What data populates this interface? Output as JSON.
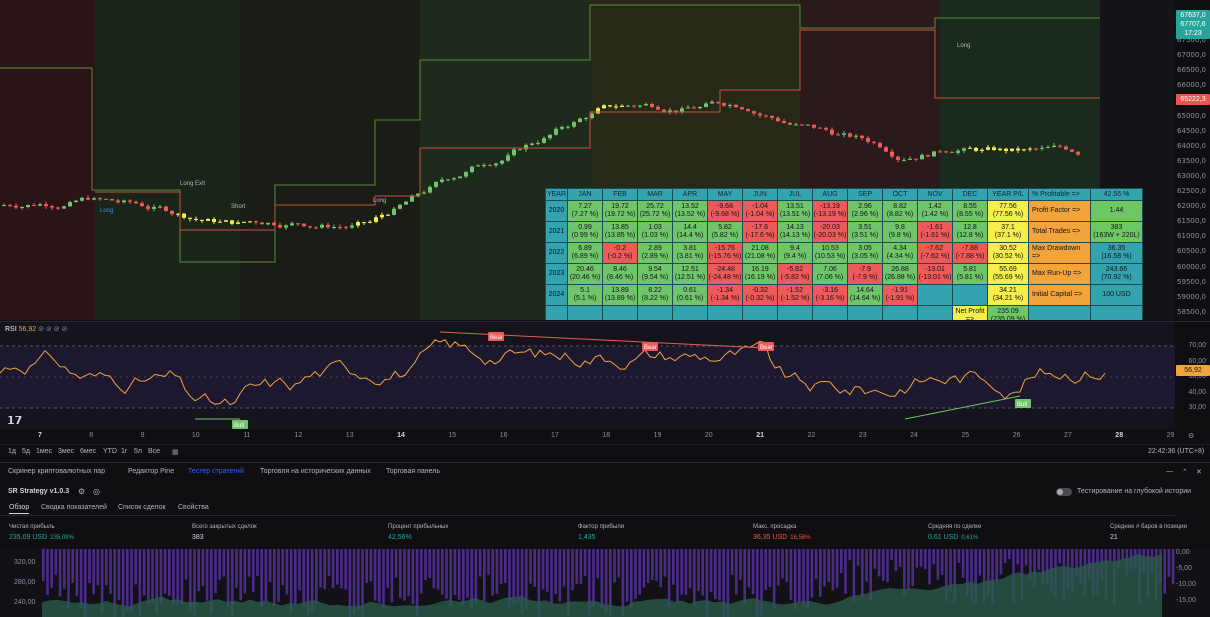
{
  "price_axis": {
    "ticks": [
      "67500,0",
      "67000,0",
      "66500,0",
      "66000,0",
      "65500,0",
      "65000,0",
      "64500,0",
      "64000,0",
      "63500,0",
      "63000,0",
      "62500,0",
      "62000,0",
      "61500,0",
      "61000,0",
      "60500,0",
      "60000,0",
      "59500,0",
      "59000,0",
      "58500,0",
      "58000,0"
    ],
    "badge_top": [
      "67637,0",
      "67707,6",
      "17:23"
    ],
    "badge_red": "65222,3"
  },
  "chart_labels": {
    "long1": "Long",
    "long_exit": "Long Exit",
    "short": "Short",
    "long2": "Long",
    "long3": "Long"
  },
  "table": {
    "headers": [
      "YEAR",
      "JAN",
      "FEB",
      "MAR",
      "APR",
      "MAY",
      "JUN",
      "JUL",
      "AUG",
      "SEP",
      "OCT",
      "NOV",
      "DEC",
      "YEAR P/L"
    ],
    "rows": [
      {
        "year": "2020",
        "cells": [
          [
            "7.27",
            "(7.27 %)",
            "pos"
          ],
          [
            "19.72",
            "(19.72 %)",
            "pos"
          ],
          [
            "25.72",
            "(25.72 %)",
            "pos"
          ],
          [
            "13.52",
            "(13.52 %)",
            "pos"
          ],
          [
            "-9.68",
            "(-9.68 %)",
            "neg"
          ],
          [
            "-1.04",
            "(-1.04 %)",
            "neg"
          ],
          [
            "13.51",
            "(13.51 %)",
            "pos"
          ],
          [
            "-13.19",
            "(-13.19 %)",
            "neg"
          ],
          [
            "2.96",
            "(2.96 %)",
            "pos"
          ],
          [
            "8.82",
            "(8.82 %)",
            "pos"
          ],
          [
            "1.42",
            "(1.42 %)",
            "pos"
          ],
          [
            "8.55",
            "(8.55 %)",
            "pos"
          ]
        ],
        "total": [
          "77.56",
          "(77.56 %)"
        ]
      },
      {
        "year": "2021",
        "cells": [
          [
            "0.99",
            "(0.99 %)",
            "pos"
          ],
          [
            "13.85",
            "(13.85 %)",
            "pos"
          ],
          [
            "1.03",
            "(1.03 %)",
            "pos"
          ],
          [
            "14.4",
            "(14.4 %)",
            "pos"
          ],
          [
            "5.82",
            "(5.82 %)",
            "pos"
          ],
          [
            "-17.6",
            "(-17.6 %)",
            "neg"
          ],
          [
            "14.13",
            "(14.13 %)",
            "pos"
          ],
          [
            "-20.03",
            "(-20.03 %)",
            "neg"
          ],
          [
            "3.51",
            "(3.51 %)",
            "pos"
          ],
          [
            "9.8",
            "(9.8 %)",
            "pos"
          ],
          [
            "-1.61",
            "(-1.61 %)",
            "neg"
          ],
          [
            "12.8",
            "(12.8 %)",
            "pos"
          ]
        ],
        "total": [
          "37.1",
          "(37.1 %)"
        ]
      },
      {
        "year": "2022",
        "cells": [
          [
            "6.89",
            "(6.89 %)",
            "pos"
          ],
          [
            "-0.2",
            "(-0.2 %)",
            "neg"
          ],
          [
            "2.89",
            "(2.89 %)",
            "pos"
          ],
          [
            "3.81",
            "(3.81 %)",
            "pos"
          ],
          [
            "-15.76",
            "(-15.76 %)",
            "neg"
          ],
          [
            "21.08",
            "(21.08 %)",
            "pos"
          ],
          [
            "9.4",
            "(9.4 %)",
            "pos"
          ],
          [
            "10.53",
            "(10.53 %)",
            "pos"
          ],
          [
            "3.05",
            "(3.05 %)",
            "pos"
          ],
          [
            "4.34",
            "(4.34 %)",
            "pos"
          ],
          [
            "-7.62",
            "(-7.62 %)",
            "neg"
          ],
          [
            "-7.88",
            "(-7.88 %)",
            "neg"
          ]
        ],
        "total": [
          "30.52",
          "(30.52 %)"
        ]
      },
      {
        "year": "2023",
        "cells": [
          [
            "20.46",
            "(20.46 %)",
            "pos"
          ],
          [
            "8.46",
            "(8.46 %)",
            "pos"
          ],
          [
            "9.54",
            "(9.54 %)",
            "pos"
          ],
          [
            "12.51",
            "(12.51 %)",
            "pos"
          ],
          [
            "-24.48",
            "(-24.48 %)",
            "neg"
          ],
          [
            "16.19",
            "(16.19 %)",
            "pos"
          ],
          [
            "-5.82",
            "(-5.82 %)",
            "neg"
          ],
          [
            "7.06",
            "(7.06 %)",
            "pos"
          ],
          [
            "-7.9",
            "(-7.9 %)",
            "neg"
          ],
          [
            "26.88",
            "(26.88 %)",
            "pos"
          ],
          [
            "-13.01",
            "(-13.01 %)",
            "neg"
          ],
          [
            "5.81",
            "(5.81 %)",
            "pos"
          ]
        ],
        "total": [
          "55.69",
          "(55.69 %)"
        ]
      },
      {
        "year": "2024",
        "cells": [
          [
            "5.1",
            "(5.1 %)",
            "pos"
          ],
          [
            "13.89",
            "(13.89 %)",
            "pos"
          ],
          [
            "8.22",
            "(8.22 %)",
            "pos"
          ],
          [
            "0.61",
            "(0.61 %)",
            "pos"
          ],
          [
            "-1.34",
            "(-1.34 %)",
            "neg"
          ],
          [
            "-0.32",
            "(-0.32 %)",
            "neg"
          ],
          [
            "-1.52",
            "(-1.52 %)",
            "neg"
          ],
          [
            "-3.16",
            "(-3.16 %)",
            "neg"
          ],
          [
            "14.64",
            "(14.64 %)",
            "pos"
          ],
          [
            "-1.91",
            "(-1.91 %)",
            "neg"
          ],
          [
            "",
            "",
            " teal"
          ],
          [
            "",
            "",
            " teal"
          ]
        ],
        "total": [
          "34.21",
          "(34.21 %)"
        ]
      }
    ],
    "net_profit_label": "Net Profit =>",
    "net_profit": [
      "235.09",
      "(235.09 %)"
    ],
    "stats": [
      [
        "% Profitable   =>",
        "42.56 %"
      ],
      [
        "Profit Factor   =>",
        "1.44"
      ],
      [
        "Total Trades   =>",
        "383",
        "(163W + 220L)"
      ],
      [
        "Max Drawdown =>",
        "36.35",
        "(16.58 %)"
      ],
      [
        "Max Run-Up   =>",
        "243.66",
        "(70.92 %)"
      ],
      [
        "Initial Capital  =>",
        "100 USD"
      ]
    ]
  },
  "rsi": {
    "title": "RSI",
    "value": "56,92",
    "ticks": [
      "70,00",
      "60,00",
      "50,00",
      "40,00",
      "30,00"
    ],
    "badge": "56,92",
    "labels": {
      "bear1": "Bear",
      "bear2": "Bear",
      "bear3": "Bear",
      "bull1": "Bull",
      "bull2": "Bull"
    }
  },
  "time_axis": [
    "7",
    "8",
    "9",
    "10",
    "11",
    "12",
    "13",
    "14",
    "15",
    "16",
    "17",
    "18",
    "19",
    "20",
    "21",
    "22",
    "23",
    "24",
    "25",
    "26",
    "27",
    "28",
    "29"
  ],
  "ranges": [
    "1д",
    "5д",
    "1мес",
    "3мес",
    "6мес",
    "YTD",
    "1г",
    "5л",
    "Все"
  ],
  "clock": "22:42:36 (UTC+8)",
  "panel_tabs": [
    "Скринер криптовалютных пар",
    "Редактор Pine",
    "Тестер стратегий",
    "Торговля на исторических данных",
    "Торговая панель"
  ],
  "strategy": {
    "name": "SR Strategy v1.0.3",
    "deep_label": "Тестирование на глубокой истории"
  },
  "sub_tabs": [
    "Обзор",
    "Сводка показателей",
    "Список сделок",
    "Свойства"
  ],
  "metrics": [
    {
      "label": "Чистая прибыль",
      "value": "235,09 USD",
      "sub": "235,09%",
      "tone": "g"
    },
    {
      "label": "Всего закрытых сделок",
      "value": "383",
      "sub": "",
      "tone": ""
    },
    {
      "label": "Процент прибыльных",
      "value": "42,56%",
      "sub": "",
      "tone": "g"
    },
    {
      "label": "Фактор прибыли",
      "value": "1,435",
      "sub": "",
      "tone": "g"
    },
    {
      "label": "Макс. просадка",
      "value": "36,35 USD",
      "sub": "16,58%",
      "tone": "r"
    },
    {
      "label": "Средняя по сделке",
      "value": "0,61 USD",
      "sub": "0,61%",
      "tone": "g"
    },
    {
      "label": "Среднее # баров в позиции",
      "value": "21",
      "sub": "",
      "tone": ""
    }
  ],
  "equity_axis_left": [
    "320,00",
    "280,00",
    "240,00"
  ],
  "equity_axis_right": [
    "0,00",
    "-5,00",
    "-10,00",
    "-15,00"
  ],
  "colors": {
    "up": "#70c46a",
    "down": "#ee5a5a",
    "signal": "#f6ee4a",
    "accent": "#2962ff"
  }
}
